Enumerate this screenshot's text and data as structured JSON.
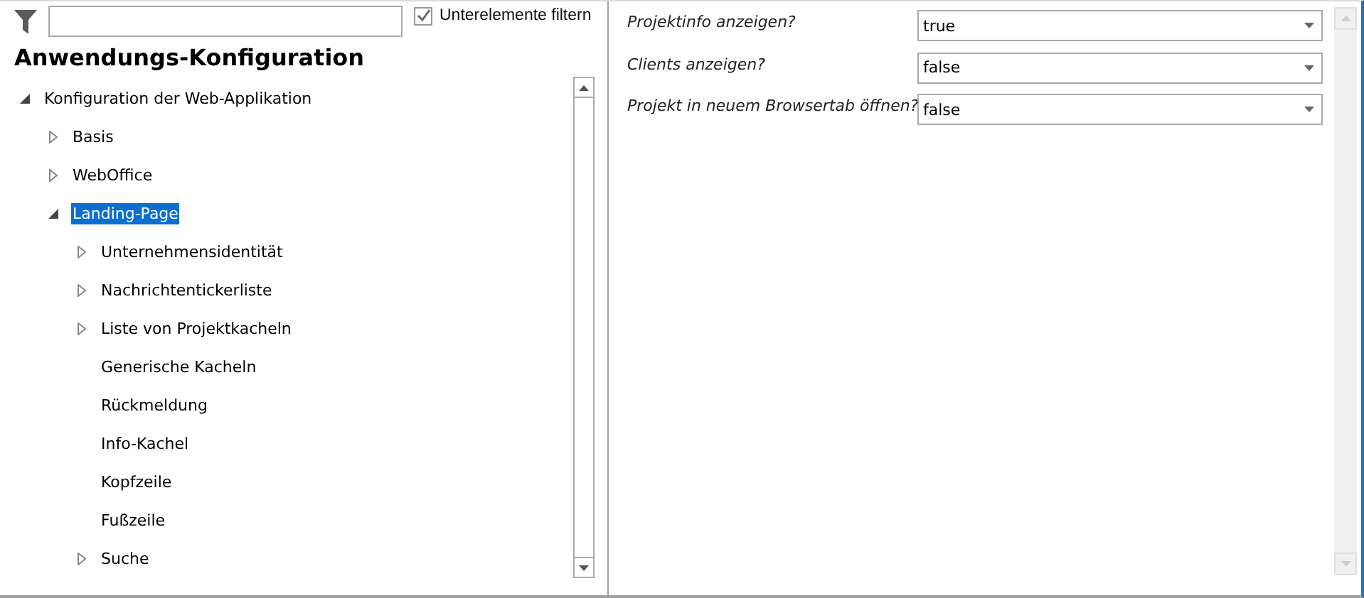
{
  "filter": {
    "subitems_checkbox": {
      "label": "Unterelemente filtern",
      "checked": true
    }
  },
  "title": "Anwendungs-Konfiguration",
  "tree": [
    {
      "label": "Konfiguration der Web-Applikation",
      "kind": "branch",
      "expanded": true,
      "selected": false,
      "children": [
        {
          "label": "Basis",
          "kind": "branch",
          "expanded": false,
          "selected": false
        },
        {
          "label": "WebOffice",
          "kind": "branch",
          "expanded": false,
          "selected": false
        },
        {
          "label": "Landing-Page",
          "kind": "branch",
          "expanded": true,
          "selected": true,
          "children": [
            {
              "label": "Unternehmensidentität",
              "kind": "branch",
              "expanded": false,
              "selected": false
            },
            {
              "label": "Nachrichtentickerliste",
              "kind": "branch",
              "expanded": false,
              "selected": false
            },
            {
              "label": "Liste von Projektkacheln",
              "kind": "branch",
              "expanded": false,
              "selected": false
            },
            {
              "label": "Generische Kacheln",
              "kind": "leaf",
              "selected": false
            },
            {
              "label": "Rückmeldung",
              "kind": "leaf",
              "selected": false
            },
            {
              "label": "Info-Kachel",
              "kind": "leaf",
              "selected": false
            },
            {
              "label": "Kopfzeile",
              "kind": "leaf",
              "selected": false
            },
            {
              "label": "Fußzeile",
              "kind": "leaf",
              "selected": false
            },
            {
              "label": "Suche",
              "kind": "branch",
              "expanded": false,
              "selected": false
            }
          ]
        }
      ]
    }
  ],
  "properties": [
    {
      "label": "Projektinfo anzeigen?",
      "value": "true"
    },
    {
      "label": "Clients anzeigen?",
      "value": "false"
    },
    {
      "label": "Projekt in neuem Browsertab öffnen?",
      "value": "false"
    }
  ]
}
